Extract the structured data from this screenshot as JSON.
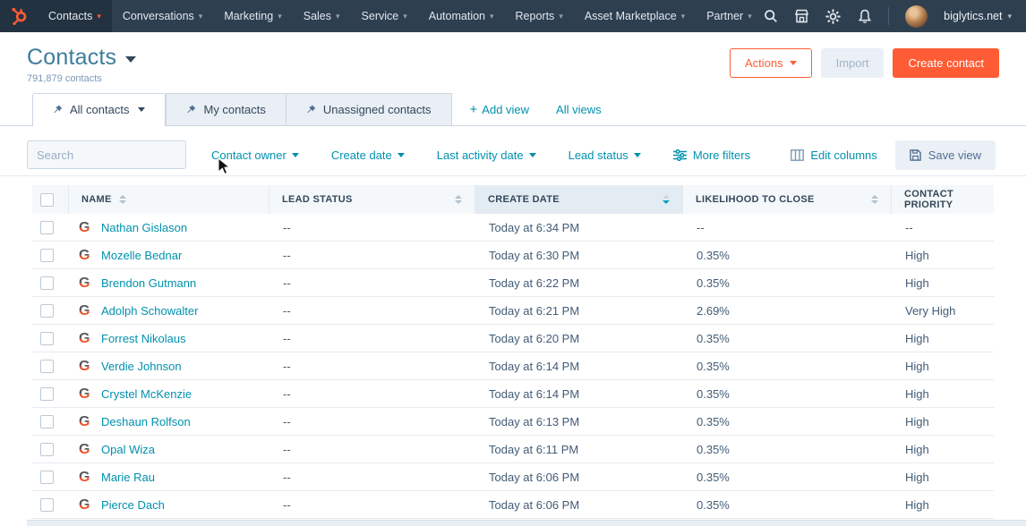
{
  "colors": {
    "accent_orange": "#ff5c35",
    "link_teal": "#0091ae",
    "nav_bg": "#2e3f50",
    "text_dark": "#33475b",
    "muted_gray": "#7c98b6",
    "sorted_header_bg": "#e4ecf3"
  },
  "nav": {
    "items": [
      {
        "label": "Contacts",
        "active": true
      },
      {
        "label": "Conversations",
        "active": false
      },
      {
        "label": "Marketing",
        "active": false
      },
      {
        "label": "Sales",
        "active": false
      },
      {
        "label": "Service",
        "active": false
      },
      {
        "label": "Automation",
        "active": false
      },
      {
        "label": "Reports",
        "active": false
      },
      {
        "label": "Asset Marketplace",
        "active": false
      },
      {
        "label": "Partner",
        "active": false
      }
    ],
    "icons": [
      "search-icon",
      "marketplace-icon",
      "settings-icon",
      "notifications-icon"
    ],
    "account_label": "biglytics.net"
  },
  "page_header": {
    "title": "Contacts",
    "subtitle": "791,879 contacts",
    "actions_button": "Actions",
    "import_button": "Import",
    "create_button": "Create contact"
  },
  "view_tabs": {
    "tabs": [
      {
        "label": "All contacts",
        "active": true,
        "has_caret": true
      },
      {
        "label": "My contacts",
        "active": false,
        "has_caret": false
      },
      {
        "label": "Unassigned contacts",
        "active": false,
        "has_caret": false
      }
    ],
    "add_view": "Add view",
    "all_views": "All views"
  },
  "filter_bar": {
    "search_placeholder": "Search",
    "dropdowns": [
      "Contact owner",
      "Create date",
      "Last activity date",
      "Lead status"
    ],
    "more_filters": "More filters",
    "edit_columns": "Edit columns",
    "save_view": "Save view"
  },
  "table": {
    "columns": [
      {
        "label": "NAME",
        "sort": "both"
      },
      {
        "label": "LEAD STATUS",
        "sort": "both"
      },
      {
        "label": "CREATE DATE",
        "sort": "desc",
        "sorted": true
      },
      {
        "label": "LIKELIHOOD TO CLOSE",
        "sort": "both"
      },
      {
        "label": "CONTACT PRIORITY",
        "sort": "none"
      }
    ],
    "rows": [
      {
        "name": "Nathan Gislason",
        "lead_status": "--",
        "create_date": "Today at 6:34 PM",
        "likelihood_to_close": "--",
        "contact_priority": "--"
      },
      {
        "name": "Mozelle Bednar",
        "lead_status": "--",
        "create_date": "Today at 6:30 PM",
        "likelihood_to_close": "0.35%",
        "contact_priority": "High"
      },
      {
        "name": "Brendon Gutmann",
        "lead_status": "--",
        "create_date": "Today at 6:22 PM",
        "likelihood_to_close": "0.35%",
        "contact_priority": "High"
      },
      {
        "name": "Adolph Schowalter",
        "lead_status": "--",
        "create_date": "Today at 6:21 PM",
        "likelihood_to_close": "2.69%",
        "contact_priority": "Very High"
      },
      {
        "name": "Forrest Nikolaus",
        "lead_status": "--",
        "create_date": "Today at 6:20 PM",
        "likelihood_to_close": "0.35%",
        "contact_priority": "High"
      },
      {
        "name": "Verdie Johnson",
        "lead_status": "--",
        "create_date": "Today at 6:14 PM",
        "likelihood_to_close": "0.35%",
        "contact_priority": "High"
      },
      {
        "name": "Crystel McKenzie",
        "lead_status": "--",
        "create_date": "Today at 6:14 PM",
        "likelihood_to_close": "0.35%",
        "contact_priority": "High"
      },
      {
        "name": "Deshaun Rolfson",
        "lead_status": "--",
        "create_date": "Today at 6:13 PM",
        "likelihood_to_close": "0.35%",
        "contact_priority": "High"
      },
      {
        "name": "Opal Wiza",
        "lead_status": "--",
        "create_date": "Today at 6:11 PM",
        "likelihood_to_close": "0.35%",
        "contact_priority": "High"
      },
      {
        "name": "Marie Rau",
        "lead_status": "--",
        "create_date": "Today at 6:06 PM",
        "likelihood_to_close": "0.35%",
        "contact_priority": "High"
      },
      {
        "name": "Pierce Dach",
        "lead_status": "--",
        "create_date": "Today at 6:06 PM",
        "likelihood_to_close": "0.35%",
        "contact_priority": "High"
      }
    ]
  }
}
